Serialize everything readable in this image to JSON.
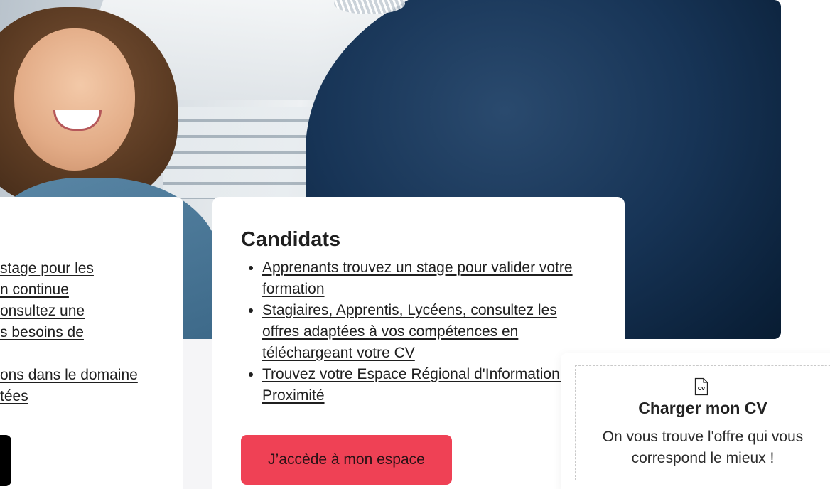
{
  "left_card": {
    "lines": [
      "stage pour les",
      "n continue",
      "onsultez une",
      "s besoins de",
      "",
      "ons dans le domaine",
      "tées"
    ]
  },
  "candidats": {
    "title": "Candidats",
    "links": [
      "Apprenants trouvez un stage pour valider votre formation",
      "Stagiaires, Apprentis, Lycéens, consultez les offres adaptées à vos compétences en téléchargeant votre CV ",
      "Trouvez votre Espace Régional d'Information de Proximité"
    ],
    "cta_label": "J’accède à mon espace"
  },
  "cv_upload": {
    "icon_label": "CV",
    "title": "Charger mon CV",
    "description": "On vous trouve l'offre qui vous correspond le mieux !"
  },
  "colors": {
    "cta_background": "#ef4155",
    "hero_dark": "#0b213a"
  },
  "icons": {
    "cv_file": "cv-file-icon"
  }
}
